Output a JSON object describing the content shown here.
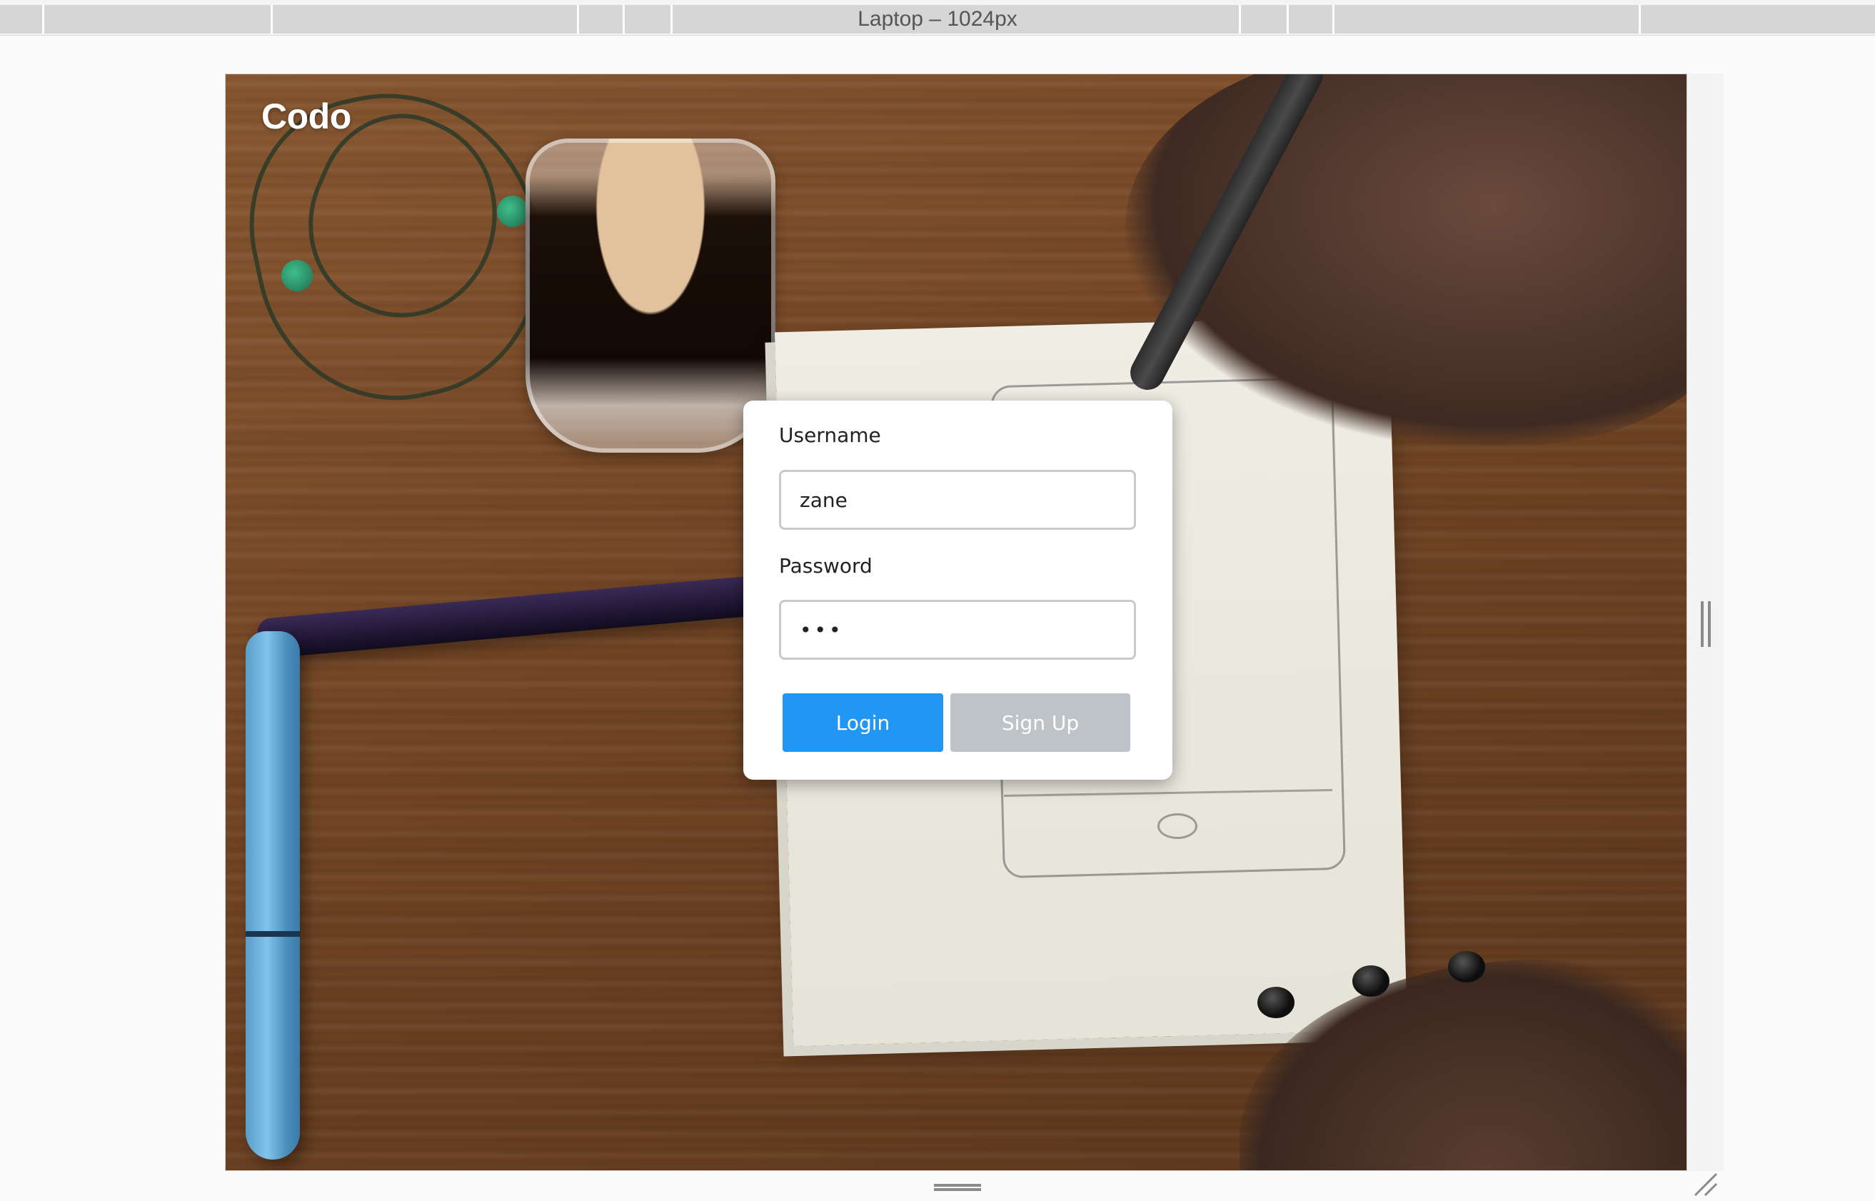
{
  "devtools": {
    "device_label": "Laptop – 1024px"
  },
  "app": {
    "brand": "Codo",
    "login_form": {
      "username_label": "Username",
      "username_value": "zane",
      "password_label": "Password",
      "password_value": "•••",
      "login_button": "Login",
      "signup_button": "Sign Up"
    }
  },
  "colors": {
    "primary_button": "#2196f3",
    "secondary_button": "#bec3c7",
    "card_background": "#ffffff"
  },
  "icons": {
    "right_resize_handle": "vertical-grip-icon",
    "bottom_resize_handle": "horizontal-grip-icon",
    "corner_resize_handle": "diagonal-resize-icon"
  }
}
